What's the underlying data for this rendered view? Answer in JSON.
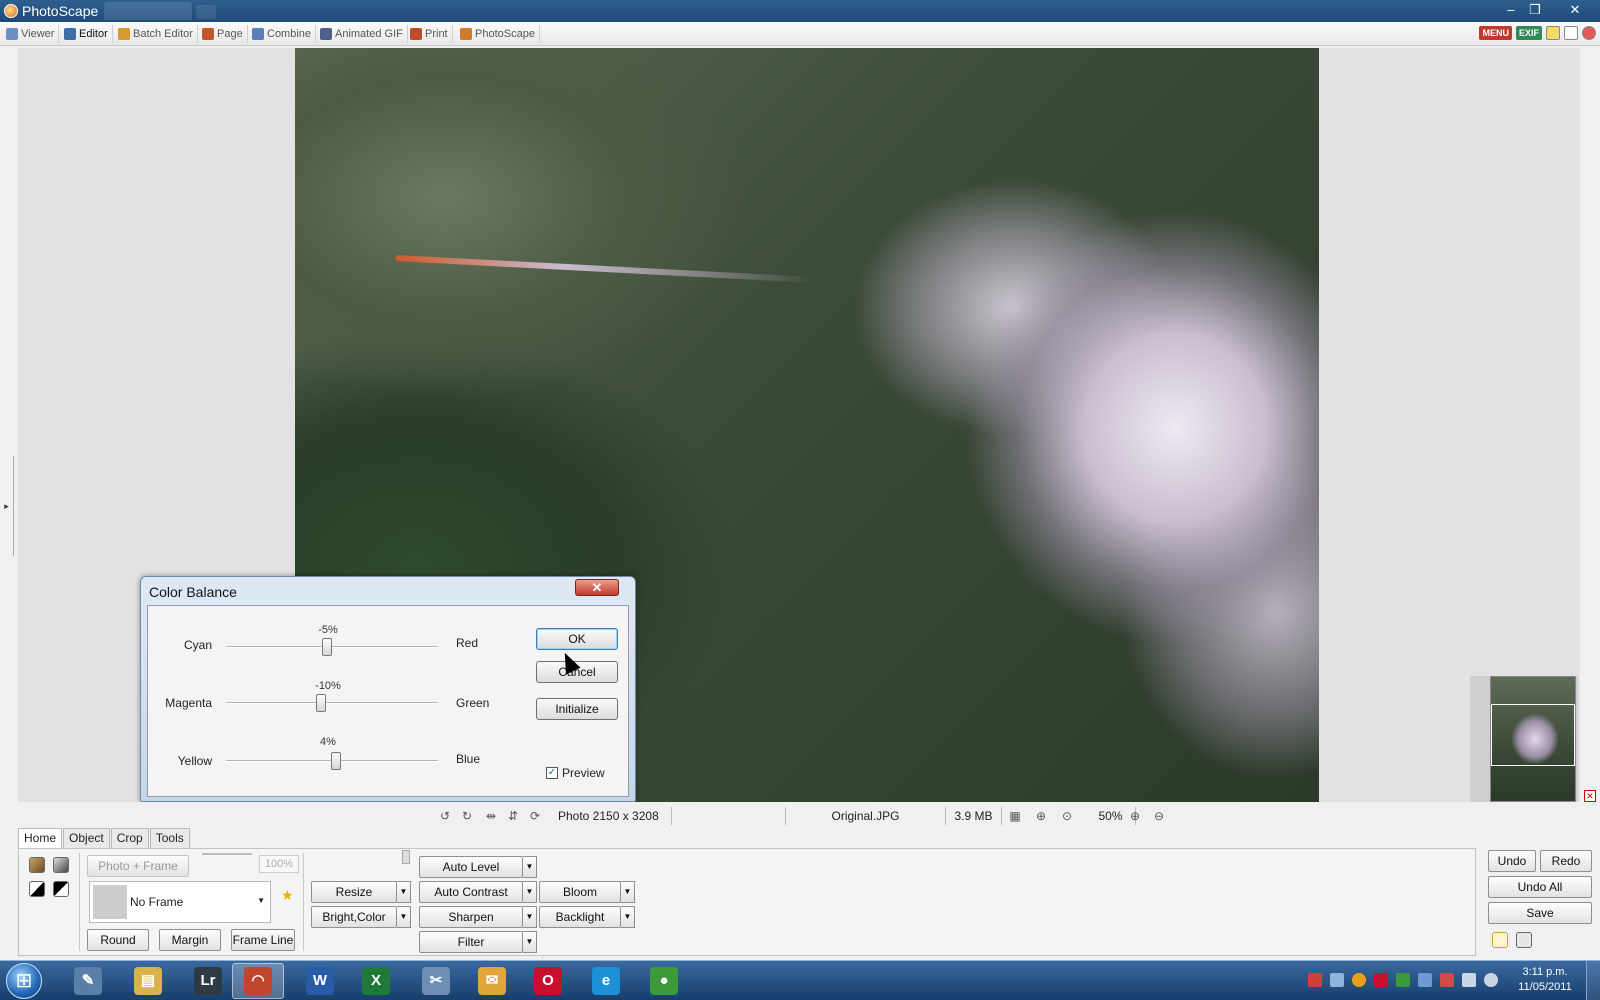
{
  "window": {
    "title": "PhotoScape",
    "minimize": "–",
    "restore": "❐",
    "close": "✕"
  },
  "menubar": {
    "items": [
      {
        "label": "Viewer",
        "icon": "viewer-icon"
      },
      {
        "label": "Editor",
        "icon": "editor-icon"
      },
      {
        "label": "Batch Editor",
        "icon": "batch-editor-icon"
      },
      {
        "label": "Page",
        "icon": "page-icon"
      },
      {
        "label": "Combine",
        "icon": "combine-icon"
      },
      {
        "label": "Animated GIF",
        "icon": "animated-gif-icon"
      },
      {
        "label": "Print",
        "icon": "print-icon"
      },
      {
        "label": "PhotoScape",
        "icon": "photoscape-icon"
      }
    ],
    "active": "Editor",
    "right_badges": {
      "menu": "MENU",
      "exif": "EXIF"
    }
  },
  "dialog": {
    "title": "Color Balance",
    "close": "✕",
    "rows": [
      {
        "left": "Cyan",
        "right": "Red",
        "value": "-5%",
        "level": -5
      },
      {
        "left": "Magenta",
        "right": "Green",
        "value": "-10%",
        "level": -10
      },
      {
        "left": "Yellow",
        "right": "Blue",
        "value": "4%",
        "level": 4
      }
    ],
    "ok": "OK",
    "cancel": "Cancel",
    "initialize": "Initialize",
    "preview_label": "Preview",
    "preview_checked": true
  },
  "statusbar": {
    "photo_size": "Photo 2150 x 3208",
    "filename": "Original.JPG",
    "filesize": "3.9 MB",
    "zoom": "50%"
  },
  "bottom": {
    "tabs": [
      "Home",
      "Object",
      "Crop",
      "Tools"
    ],
    "active_tab": "Home",
    "photo_frame": "Photo + Frame",
    "opacity": "100%",
    "frame_name": "No Frame",
    "round": "Round",
    "margin": "Margin",
    "frame_line": "Frame Line",
    "resize": "Resize",
    "bright_color": "Bright,Color",
    "auto_level": "Auto Level",
    "auto_contrast": "Auto Contrast",
    "sharpen": "Sharpen",
    "filter": "Filter",
    "bloom": "Bloom",
    "backlight": "Backlight",
    "undo": "Undo",
    "redo": "Redo",
    "undo_all": "Undo All",
    "save": "Save"
  },
  "taskbar": {
    "apps": [
      {
        "name": "windows-explorer-tool",
        "glyph": "✎",
        "color": "#5a7fa6"
      },
      {
        "name": "file-explorer",
        "glyph": "▤",
        "color": "#d8b24a"
      },
      {
        "name": "lightroom",
        "glyph": "Lr",
        "color": "#2f3a44"
      },
      {
        "name": "photoscape",
        "glyph": "◠",
        "color": "#c0452c"
      },
      {
        "name": "word",
        "glyph": "W",
        "color": "#2a5ba8"
      },
      {
        "name": "excel",
        "glyph": "X",
        "color": "#1f7a3a"
      },
      {
        "name": "utility",
        "glyph": "✂",
        "color": "#6e8fb3"
      },
      {
        "name": "outlook",
        "glyph": "✉",
        "color": "#e0a63a"
      },
      {
        "name": "opera",
        "glyph": "O",
        "color": "#c8102e"
      },
      {
        "name": "internet-explorer",
        "glyph": "e",
        "color": "#1e90d6"
      },
      {
        "name": "chrome",
        "glyph": "●",
        "color": "#3c9a3a"
      }
    ],
    "active_app": "photoscape",
    "clock_time": "3:11 p.m.",
    "clock_date": "11/05/2011"
  },
  "colors": {
    "titlebar": "#1d4a78",
    "dialog_header": "#c5d6ea",
    "accent_button": "#3c7fb1",
    "menu_badge": "#c0392b",
    "exif_badge": "#2e8b57"
  }
}
